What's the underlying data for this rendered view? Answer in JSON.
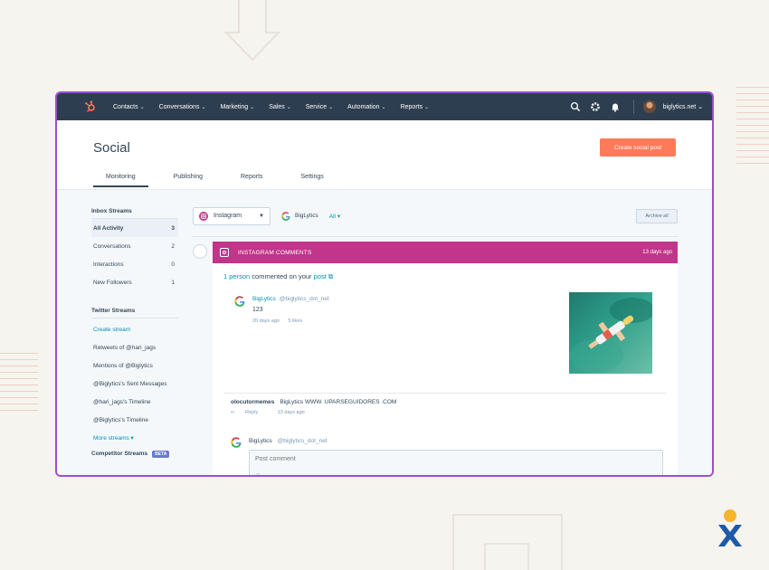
{
  "nav": {
    "items": [
      "Contacts",
      "Conversations",
      "Marketing",
      "Sales",
      "Service",
      "Automation",
      "Reports"
    ],
    "account": "biglytics.net"
  },
  "header": {
    "title": "Social",
    "create_button": "Create social post",
    "tabs": [
      "Monitoring",
      "Publishing",
      "Reports",
      "Settings"
    ]
  },
  "sidebar": {
    "inbox_title": "Inbox Streams",
    "inbox": [
      {
        "label": "All Activity",
        "count": "3"
      },
      {
        "label": "Conversations",
        "count": "2"
      },
      {
        "label": "Interactions",
        "count": "0"
      },
      {
        "label": "New Followers",
        "count": "1"
      }
    ],
    "twitter_title": "Twitter Streams",
    "create_stream": "Create stream",
    "twitter": [
      "Retweets of @hari_jags",
      "Mentions of @Biglytics",
      "@Biglytics's Sent Messages",
      "@hari_jags's Timeline",
      "@Biglytics's Timeline"
    ],
    "more_streams": "More streams",
    "competitor_title": "Competitor Streams",
    "beta": "BETA"
  },
  "filters": {
    "network": "Instagram",
    "account": "BigLytics",
    "all": "All",
    "archive": "Archive all"
  },
  "card": {
    "title": "INSTAGRAM COMMENTS",
    "time": "13 days ago",
    "summary_count": "1 person",
    "summary_text": " commented on your ",
    "summary_link": "post",
    "post": {
      "author": "BigLytics",
      "handle": "@biglytics_dot_net",
      "text": "123",
      "time": "20 days ago",
      "likes": "5 likes"
    },
    "comment": {
      "author": "olocutormemes",
      "text": "BigLytics WWW. UPARSEGUIDORES .COM",
      "reply": "Reply",
      "time": "13 days ago"
    },
    "reply": {
      "author": "BigLytics",
      "handle": "@biglytics_dot_net",
      "placeholder": "Post comment"
    }
  },
  "colors": {
    "nav_bg": "#2d3e50",
    "accent": "#ff7a59",
    "instagram": "#c1358a",
    "link": "#0091ae",
    "border": "#9b4fd1"
  }
}
